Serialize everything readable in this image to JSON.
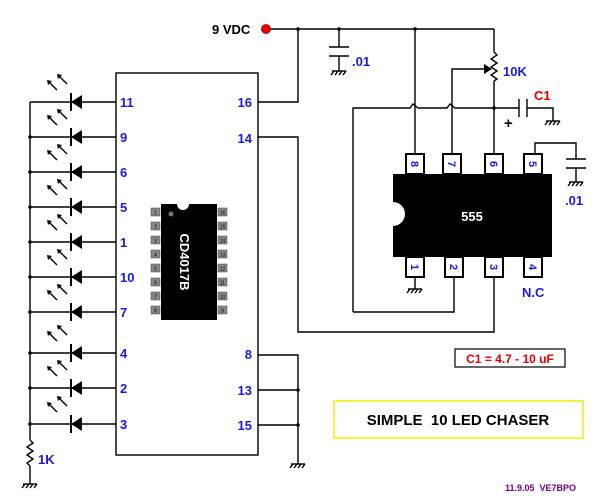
{
  "title": "SIMPLE  10 LED CHASER",
  "credit": "11.9.05  VE7BPO",
  "supply": {
    "label": "9 VDC",
    "color": "#e60000"
  },
  "note": "C1 = 4.7 - 10 uF",
  "colors": {
    "pin_label": "#1a1ae6",
    "c1_label": "#e60000",
    "title_border": "#f0f000",
    "credit": "#800080"
  },
  "cd4017": {
    "part_label": "CD4017B",
    "left_pins": [
      "11",
      "9",
      "6",
      "5",
      "1",
      "10",
      "7",
      "4",
      "2",
      "3"
    ],
    "right_pins_top": [
      "16",
      "14"
    ],
    "right_pins_bottom": [
      "8",
      "13",
      "15"
    ],
    "package_left_pins": [
      "1",
      "2",
      "3",
      "4",
      "5",
      "6",
      "7",
      "8"
    ],
    "package_right_pins": [
      "16",
      "15",
      "14",
      "13",
      "12",
      "11",
      "10",
      "9"
    ]
  },
  "ic555": {
    "part_label": "555",
    "top_pins": [
      "8",
      "7",
      "6",
      "5"
    ],
    "bottom_pins": [
      "1",
      "2",
      "3",
      "4"
    ],
    "nc_label": "N.C"
  },
  "components": {
    "cap_supply": ".01",
    "cap_ctrl": ".01",
    "pot": "10K",
    "c1": "C1",
    "c1_polarity": "+",
    "resistor": "1K"
  }
}
